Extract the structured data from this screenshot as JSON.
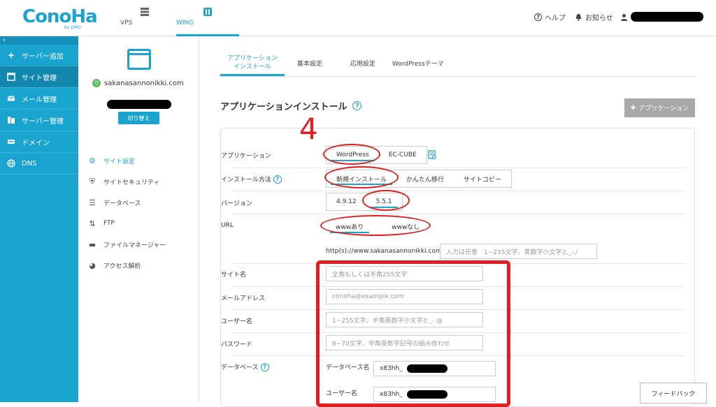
{
  "brand": {
    "logo": "ConoHa",
    "logo_sub": "by GMO"
  },
  "top_nav": [
    {
      "label": "VPS",
      "icon": "server-icon"
    },
    {
      "label": "WING",
      "icon": "wing-icon"
    }
  ],
  "header": {
    "help": "ヘルプ",
    "notice": "お知らせ"
  },
  "sidebar": {
    "toggle": "‹",
    "items": [
      {
        "label": "サーバー追加",
        "icon": "plus-icon"
      },
      {
        "label": "サイト管理",
        "icon": "site-icon"
      },
      {
        "label": "メール管理",
        "icon": "mail-icon"
      },
      {
        "label": "サーバー管理",
        "icon": "server-icon"
      },
      {
        "label": "ドメイン",
        "icon": "domain-icon"
      },
      {
        "label": "DNS",
        "icon": "globe-icon"
      }
    ]
  },
  "site": {
    "domain": "sakanasannonikki.com",
    "switch_label": "切り替え"
  },
  "sub_nav": [
    {
      "label": "サイト設定",
      "icon": "site-settings-icon"
    },
    {
      "label": "サイトセキュリティ",
      "icon": "shield-icon"
    },
    {
      "label": "データベース",
      "icon": "database-icon"
    },
    {
      "label": "FTP",
      "icon": "ftp-icon"
    },
    {
      "label": "ファイルマネージャー",
      "icon": "folder-icon"
    },
    {
      "label": "アクセス解析",
      "icon": "pie-chart-icon"
    }
  ],
  "tabs": [
    {
      "label": "アプリケーション\nインストール"
    },
    {
      "label": "基本設定"
    },
    {
      "label": "応用設定"
    },
    {
      "label": "WordPressテーマ"
    }
  ],
  "page": {
    "title": "アプリケーションインストール",
    "add_button": "アプリケーション"
  },
  "form": {
    "application": {
      "label": "アプリケーション",
      "options": [
        "WordPress",
        "EC-CUBE"
      ]
    },
    "install_method": {
      "label": "インストール方法",
      "options": [
        "新規インストール",
        "かんたん移行",
        "サイトコピー"
      ]
    },
    "version": {
      "label": "バージョン",
      "options": [
        "4.9.12",
        "5.5.1"
      ]
    },
    "url": {
      "label": "URL",
      "options": [
        "wwwあり",
        "wwwなし"
      ],
      "prefix": "http(s)://www.sakanasannonikki.com/",
      "placeholder": "入力は任意　1~255文字、英数字小文字と_-./"
    },
    "site_name": {
      "label": "サイト名",
      "placeholder": "全角もしくは半角255文字"
    },
    "email": {
      "label": "メールアドレス",
      "placeholder": "conoha@example.com"
    },
    "username": {
      "label": "ユーザー名",
      "placeholder": "1~255文字、半角英数字小文字と_-.@"
    },
    "password": {
      "label": "パスワード",
      "placeholder": "8~70文字、半角英数字記号の組み合わせ"
    },
    "database": {
      "label": "データベース",
      "db_name_label": "データベース名",
      "db_prefix": "x83hh_",
      "user_label": "ユーザー名",
      "user_prefix": "x83hh_"
    }
  },
  "annotation_number": "4",
  "feedback": "フィードバック",
  "colors": {
    "accent": "#19a3cf",
    "annotation": "#e02020"
  }
}
